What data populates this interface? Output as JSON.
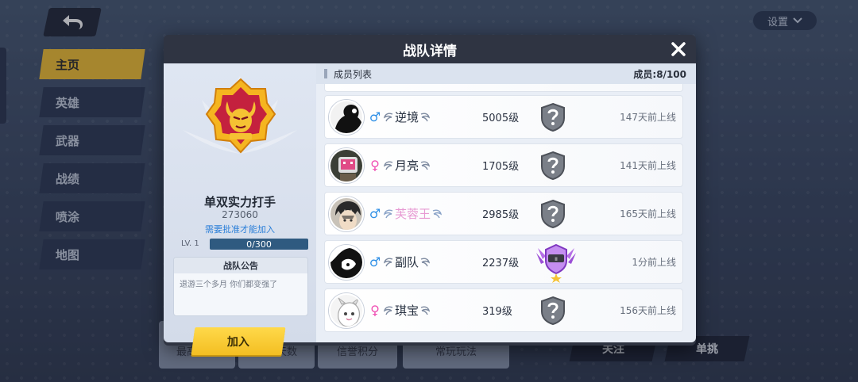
{
  "background": {
    "settings_label": "设置",
    "nav": [
      "主页",
      "英雄",
      "武器",
      "战绩",
      "喷涂",
      "地图"
    ],
    "bottom_cards": [
      "最高段位",
      "游戏天数",
      "信誉积分",
      "常玩玩法"
    ],
    "follow_button": "关注",
    "solo_button": "单挑"
  },
  "modal": {
    "title": "战队详情",
    "team": {
      "name": "单双实力打手",
      "id": "273060",
      "join_requirement": "需要批准才能加入",
      "level_label": "LV. 1",
      "exp_text": "0/300",
      "exp_progress": 0
    },
    "notice": {
      "title": "战队公告",
      "content": "退游三个多月 你们都变强了"
    },
    "join_button": "加入",
    "member_list": {
      "title": "成员列表",
      "count": "成员:8/100",
      "members": [
        {
          "name": "逆境",
          "gender": "male",
          "gender_symbol": "♂",
          "level": "5005级",
          "rank": "unknown",
          "last_online": "147天前上线",
          "avatar": "dark-silhouette"
        },
        {
          "name": "月亮",
          "gender": "female",
          "gender_symbol": "♀",
          "level": "1705级",
          "rank": "unknown",
          "last_online": "141天前上线",
          "avatar": "tv-head"
        },
        {
          "name": "芙蓉王",
          "gender": "male",
          "gender_symbol": "♂",
          "level": "2985级",
          "rank": "unknown",
          "last_online": "165天前上线",
          "avatar": "anime-boy"
        },
        {
          "name": "副队",
          "gender": "male",
          "gender_symbol": "♂",
          "level": "2237级",
          "rank": "purple-winged",
          "last_online": "1分前上线",
          "avatar": "bw-sketch"
        },
        {
          "name": "琪宝",
          "gender": "female",
          "gender_symbol": "♀",
          "level": "319级",
          "rank": "unknown",
          "last_online": "156天前上线",
          "avatar": "white-creature"
        }
      ]
    }
  },
  "colors": {
    "accent_yellow": "#f5c233",
    "male_blue": "#2e8fe6",
    "female_pink": "#f04fb3",
    "link_blue": "#2b7fd8"
  }
}
